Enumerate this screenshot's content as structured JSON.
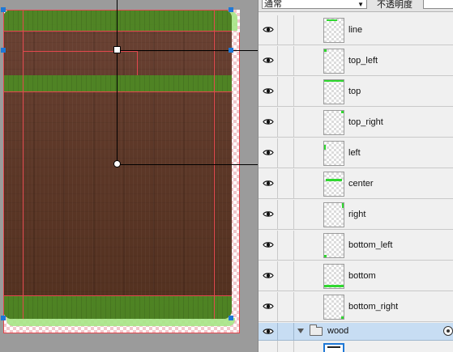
{
  "panel": {
    "blend_mode": "通常",
    "opacity_label": "不透明度",
    "opacity_value": ""
  },
  "layers": [
    {
      "name": "line",
      "visible": true,
      "thumb": "top-line-icon"
    },
    {
      "name": "top_left",
      "visible": true,
      "thumb": "top-left-corner-icon"
    },
    {
      "name": "top",
      "visible": true,
      "thumb": "top-edge-icon"
    },
    {
      "name": "top_right",
      "visible": true,
      "thumb": "top-right-corner-icon"
    },
    {
      "name": "left",
      "visible": true,
      "thumb": "left-edge-icon"
    },
    {
      "name": "center",
      "visible": true,
      "thumb": "center-icon"
    },
    {
      "name": "right",
      "visible": true,
      "thumb": "right-edge-icon"
    },
    {
      "name": "bottom_left",
      "visible": true,
      "thumb": "bottom-left-corner-icon"
    },
    {
      "name": "bottom",
      "visible": true,
      "thumb": "bottom-edge-icon"
    },
    {
      "name": "bottom_right",
      "visible": true,
      "thumb": "bottom-right-corner-icon"
    }
  ],
  "group": {
    "name": "wood",
    "expanded": true,
    "visible": true
  },
  "colors": {
    "wood": "#5d3828",
    "green": "#4e8a24",
    "light_green": "#a6e586",
    "slice_guide": "#e2484e",
    "selection_handle": "#1e78d6",
    "thumb_mark": "#2fd82f"
  }
}
